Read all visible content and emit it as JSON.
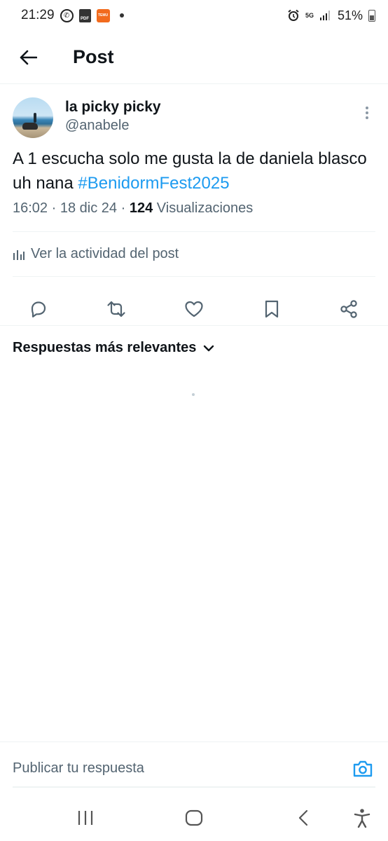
{
  "status_bar": {
    "time": "21:29",
    "network": "5G",
    "battery": "51%",
    "icons": [
      "whatsapp-icon",
      "pdf-icon",
      "temu-icon",
      "notification-dot-icon",
      "alarm-icon",
      "signal-icon",
      "battery-icon"
    ],
    "temu_label": "TEMU",
    "pdf_label": "PDF"
  },
  "header": {
    "title": "Post",
    "back_icon": "arrow-left-icon"
  },
  "post": {
    "author_name": "la picky picky",
    "author_handle": "@anabele",
    "text_plain": "A 1 escucha solo me gusta la de daniela blasco uh nana ",
    "hashtag": "#BenidormFest2025",
    "time": "16:02",
    "date": "18 dic 24",
    "separator": "·",
    "views_count": "124",
    "views_label": "Visualizaciones",
    "activity_label": "Ver la actividad del post",
    "actions": [
      "reply-icon",
      "repost-icon",
      "like-icon",
      "bookmark-icon",
      "share-icon"
    ]
  },
  "replies": {
    "sort_label": "Respuestas más relevantes"
  },
  "composer": {
    "placeholder": "Publicar tu respuesta",
    "camera_icon": "camera-icon"
  },
  "nav": [
    "recent-apps-icon",
    "home-icon",
    "back-icon",
    "accessibility-icon"
  ],
  "colors": {
    "accent": "#1d9bf0",
    "text": "#0f1419",
    "muted": "#536471",
    "divider": "#eff3f4"
  }
}
